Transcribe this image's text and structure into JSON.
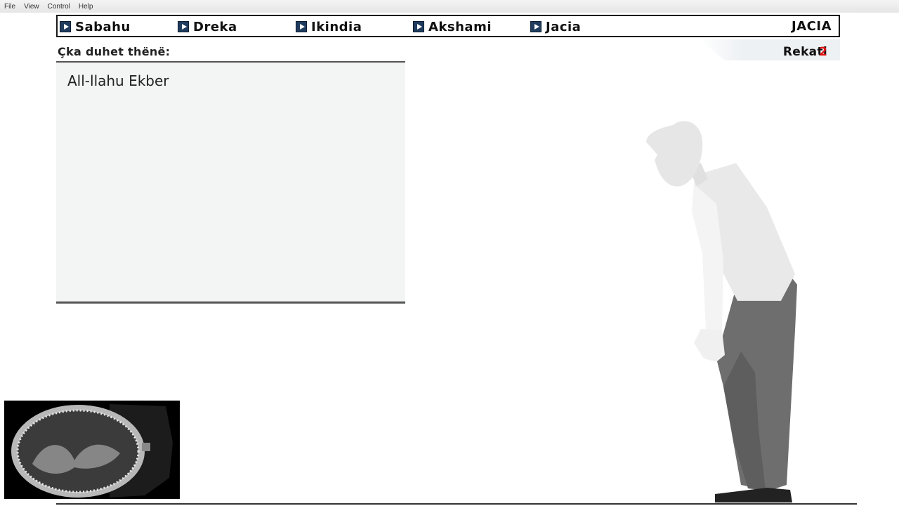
{
  "menu": [
    "File",
    "View",
    "Control",
    "Help"
  ],
  "nav": {
    "items": [
      {
        "label": "Sabahu"
      },
      {
        "label": "Dreka"
      },
      {
        "label": "Ikindia"
      },
      {
        "label": "Akshami"
      },
      {
        "label": "Jacia"
      }
    ],
    "current": "JACIA"
  },
  "prompt_label": "Çka duhet thënë:",
  "panel_text": "All-llahu Ekber",
  "rekati": {
    "label": "Rekati",
    "number": "2"
  },
  "colors": {
    "accent_red": "#e01010",
    "nav_button": "#1f3c5e"
  }
}
